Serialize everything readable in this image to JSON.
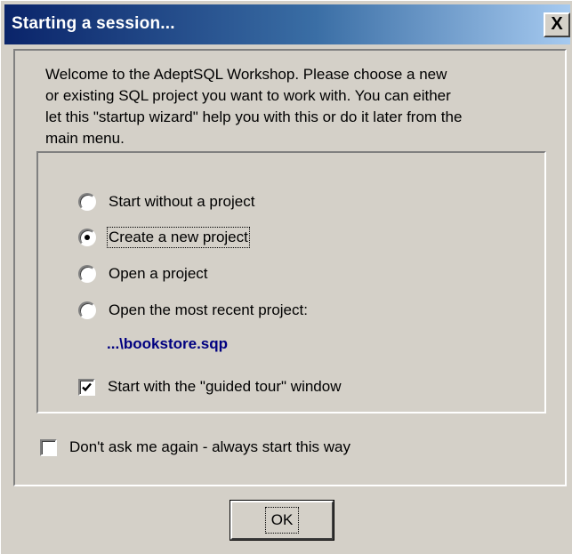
{
  "window": {
    "title": "Starting a session...",
    "close_label": "X"
  },
  "welcome_text": "Welcome to the AdeptSQL Workshop.  Please choose a new\nor existing SQL project you want to work with.  You can either\nlet this \"startup wizard\" help you with this or do it later from the\nmain menu.",
  "options": {
    "start_without": {
      "label": "Start without a project",
      "selected": false
    },
    "create_new": {
      "label": "Create a new project",
      "selected": true
    },
    "open_project": {
      "label": "Open a project",
      "selected": false
    },
    "open_recent": {
      "label": "Open the most recent project:",
      "selected": false
    },
    "recent_path": "...\\bookstore.sqp"
  },
  "guided_tour": {
    "label": "Start with the \"guided tour\" window",
    "checked": true
  },
  "dont_ask": {
    "label": "Don't ask me again - always start this way",
    "checked": false
  },
  "buttons": {
    "ok_label": "OK"
  },
  "colors": {
    "titlebar_start": "#0a246a",
    "titlebar_end": "#a6caf0",
    "dialog_face": "#d4d0c8",
    "recent_path": "#000080"
  }
}
